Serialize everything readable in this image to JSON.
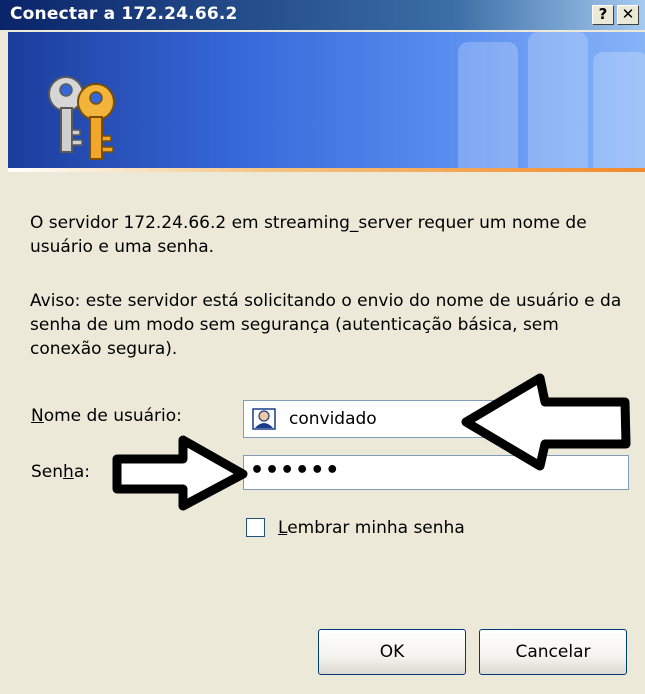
{
  "window": {
    "title": "Conectar a 172.24.66.2",
    "help_glyph": "?",
    "close_glyph": "✕"
  },
  "banner": {
    "icon": "keys-icon"
  },
  "messages": {
    "server_info": "O servidor 172.24.66.2 em streaming_server requer um nome de usuário e uma senha.",
    "warning": "Aviso: este servidor está solicitando o envio do nome de usuário e da senha de um modo sem segurança (autenticação básica, sem conexão segura)."
  },
  "form": {
    "username_label_prefix": "N",
    "username_label_rest": "ome de usuário:",
    "username_value": "convidado",
    "password_label_prefix": "Sen",
    "password_label_underline": "h",
    "password_label_suffix": "a:",
    "password_value": "••••••",
    "remember_underline": "L",
    "remember_rest": "embrar minha senha",
    "remember_checked": false
  },
  "buttons": {
    "ok": "OK",
    "cancel": "Cancelar"
  },
  "colors": {
    "title_bar": "#0a246a",
    "banner": "#3667d8",
    "accent_line": "#f08a2c",
    "dialog_bg": "#ece9d8"
  }
}
